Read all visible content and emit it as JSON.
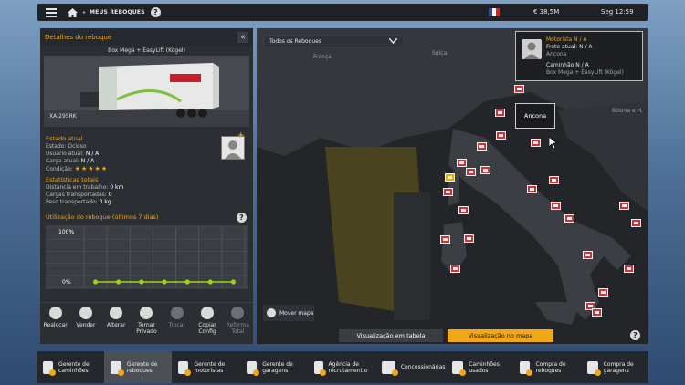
{
  "topbar": {
    "breadcrumb": "MEUS REBOQUES",
    "money": "€ 38,5M",
    "clock": "Seg 12:59",
    "help": "?",
    "sep": "▸",
    "colors": {
      "accent": "#f0a818"
    }
  },
  "trailer": {
    "panel_title": "Detalhes do reboque",
    "collapse": "«",
    "name": "Box Mega + EasyLift (Kögel)",
    "plate": "XA 295RK",
    "estado_h": "Estado atual",
    "estado": "Estado: Ocioso",
    "usuario_label": "Usuário atual:",
    "usuario_val": "N / A",
    "carga_label": "Carga atual:",
    "carga_val": "N / A",
    "condicao_label": "Condição:",
    "condicao_stars": "★★★★★",
    "stats_h": "Estatísticas totais",
    "dist_label": "Distância em trabalho:",
    "dist_val": "0 km",
    "cargas_label": "Cargas transportadas:",
    "cargas_val": "0",
    "peso_label": "Peso transportado:",
    "peso_val": "0 kg",
    "usage_h": "Utilização do reboque (últimos 7 dias)",
    "usage_max": "100%",
    "usage_min": "0%",
    "usage_values": [
      0,
      0,
      0,
      0,
      0,
      0,
      0
    ]
  },
  "actions": [
    {
      "label": "Realocar"
    },
    {
      "label": "Vender"
    },
    {
      "label": "Alterar"
    },
    {
      "label": "Tornar Privado"
    },
    {
      "label": "Trocar"
    },
    {
      "label": "Copiar Config"
    },
    {
      "label": "Reforma Total"
    }
  ],
  "map": {
    "dropdown": "Todos os Reboques",
    "labels": {
      "franca": "França",
      "suica": "Suíça",
      "bosnia": "Bósnia e H."
    },
    "info_title": "Motorista N / A",
    "info_frete": "Frete atual: N / A",
    "info_city": "Ancona",
    "info_caminhao": "Caminhão N / A",
    "info_trailer": "Box Mega + EasyLift (Kögel)",
    "tooltip": "Ancona",
    "move_btn": "Mover mapa",
    "tab_table": "Visualização em tabela",
    "tab_map": "Visualização no mapa"
  },
  "bottom_nav": [
    {
      "label": "Gerente de caminhões"
    },
    {
      "label": "Gerente de reboques"
    },
    {
      "label": "Gerente de motoristas"
    },
    {
      "label": "Gerente de garagens"
    },
    {
      "label": "Agência de recrutament o"
    },
    {
      "label": "Concessionárias"
    },
    {
      "label": "Caminhões usados"
    },
    {
      "label": "Compra de reboques"
    },
    {
      "label": "Compra de garagens"
    }
  ]
}
